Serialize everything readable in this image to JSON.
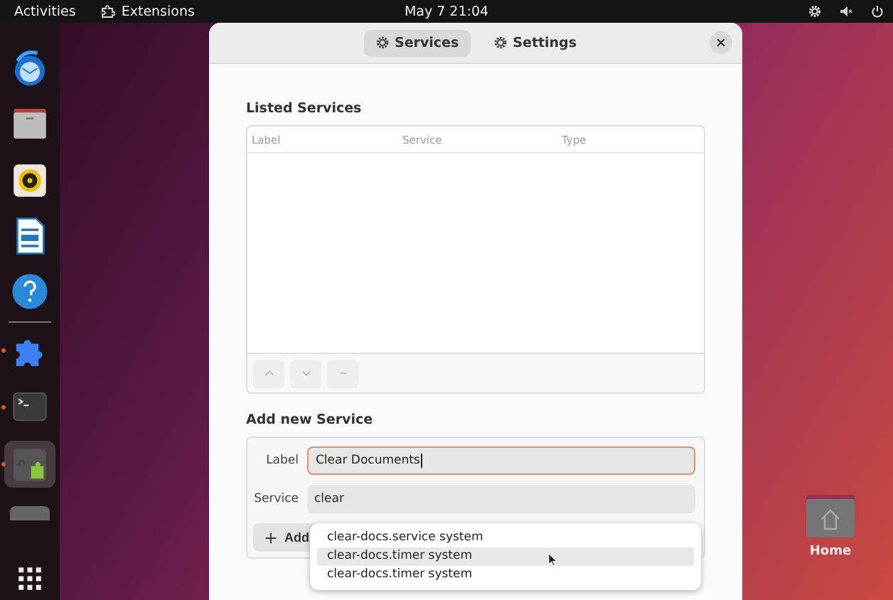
{
  "top_bar": {
    "activities": "Activities",
    "app_menu": "Extensions",
    "clock": "May 7  21:04"
  },
  "dock": {
    "items": [
      {
        "kind": "mail",
        "running": false,
        "selected": false
      },
      {
        "kind": "files",
        "running": false,
        "selected": false
      },
      {
        "kind": "music",
        "running": false,
        "selected": false
      },
      {
        "kind": "writer",
        "running": false,
        "selected": false
      },
      {
        "kind": "help",
        "running": false,
        "selected": false
      },
      {
        "kind": "puzzle",
        "running": true,
        "selected": false
      },
      {
        "kind": "terminal",
        "running": true,
        "selected": false
      },
      {
        "kind": "extension-manager",
        "running": true,
        "selected": true
      },
      {
        "kind": "partial",
        "running": false,
        "selected": false
      },
      {
        "kind": "apps",
        "running": false,
        "selected": false
      }
    ]
  },
  "window": {
    "tabs": [
      {
        "label": "Services",
        "selected": true
      },
      {
        "label": "Settings",
        "selected": false
      }
    ],
    "listed_services": {
      "title": "Listed Services",
      "columns": [
        "Label",
        "Service",
        "Type"
      ]
    },
    "add_new": {
      "title": "Add new Service",
      "label_field": {
        "label": "Label",
        "value": "Clear Documents"
      },
      "service_field": {
        "label": "Service",
        "value": "clear"
      },
      "add_button": "Add"
    },
    "suggestions": [
      {
        "text": "clear-docs.service system",
        "selected": false
      },
      {
        "text": "clear-docs.timer system",
        "selected": true
      },
      {
        "text": "clear-docs.timer system",
        "selected": false
      }
    ]
  },
  "desktop": {
    "icons": [
      {
        "label": "Home"
      }
    ]
  }
}
